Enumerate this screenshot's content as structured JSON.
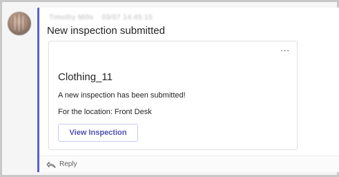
{
  "message": {
    "sender_name": "Timothy Mills",
    "sender_time": "03/07 14:45:15",
    "title": "New inspection submitted"
  },
  "card": {
    "more_label": "...",
    "title": "Clothing_11",
    "line1": "A new inspection has been submitted!",
    "line2": "For the location: Front Desk",
    "button_label": "View Inspection"
  },
  "reply": {
    "label": "Reply",
    "icon": "reply-arrow-icon"
  },
  "colors": {
    "accent": "#5b5fc7",
    "button_text": "#4f52b2",
    "frame_border": "#c8c8c8"
  }
}
